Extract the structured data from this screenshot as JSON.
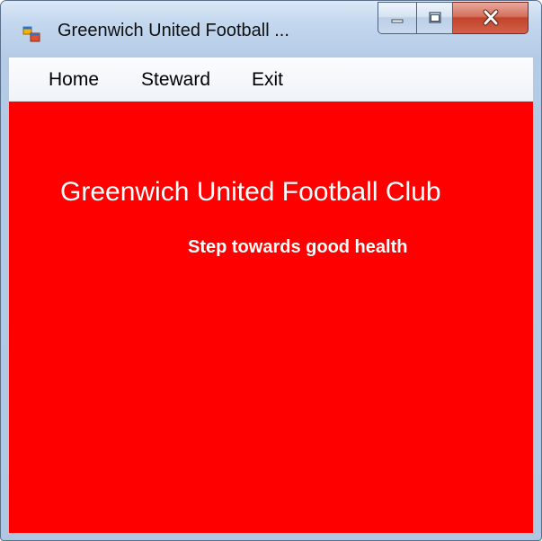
{
  "window": {
    "title": "Greenwich United Football ..."
  },
  "menu": {
    "items": [
      {
        "label": "Home"
      },
      {
        "label": "Steward"
      },
      {
        "label": "Exit"
      }
    ]
  },
  "content": {
    "title": "Greenwich United Football Club",
    "tagline": "Step towards good health",
    "background_color": "#ff0000",
    "text_color": "#ffffff"
  },
  "icons": {
    "app": "app-form-icon",
    "minimize": "minimize-icon",
    "maximize": "maximize-icon",
    "close": "close-icon"
  }
}
